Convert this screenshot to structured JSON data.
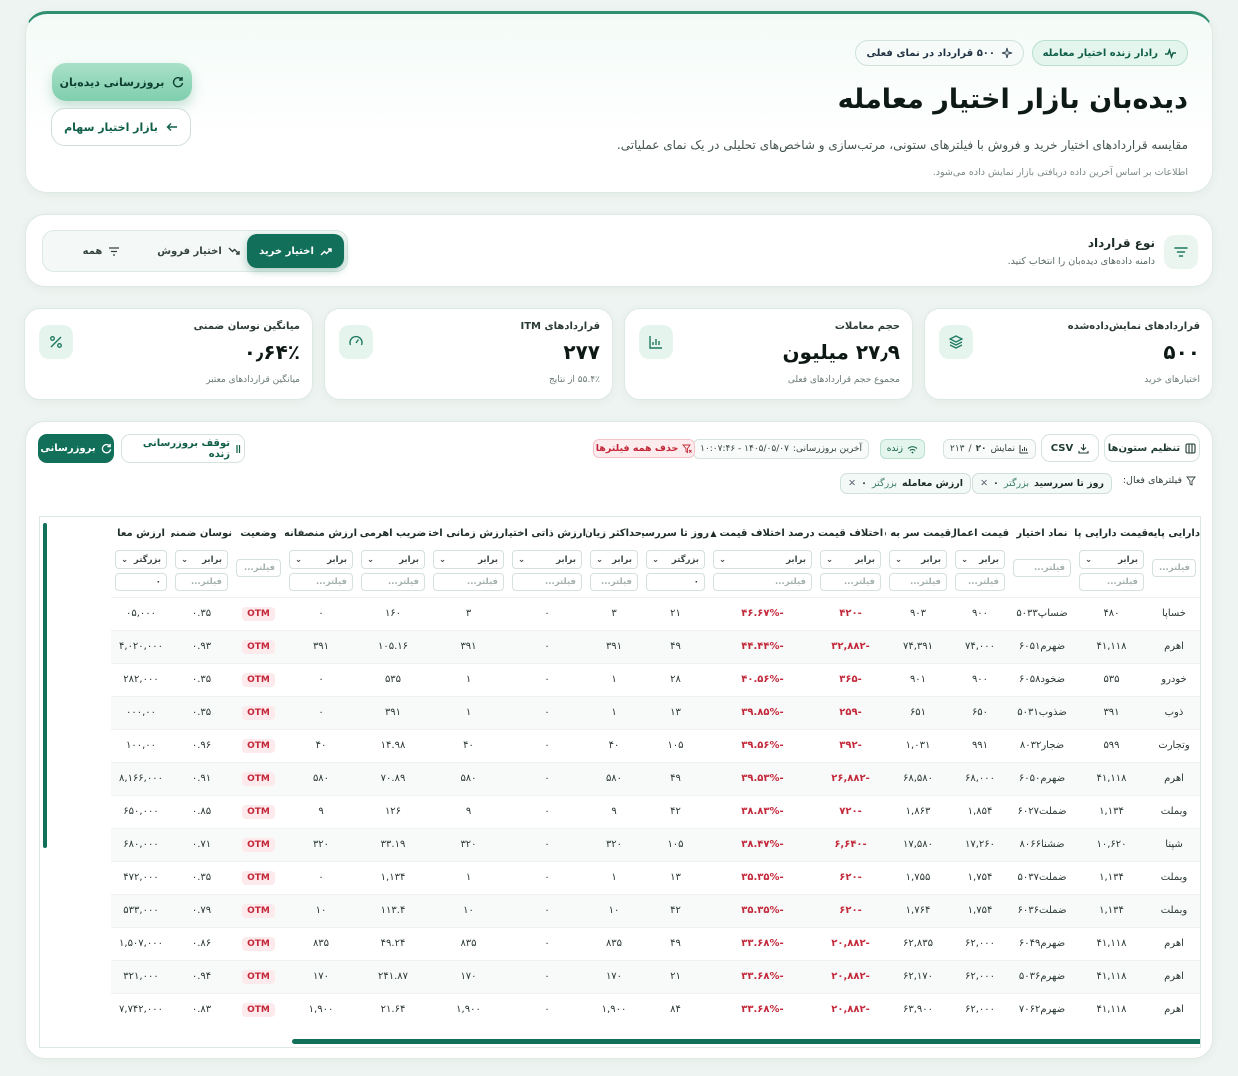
{
  "header": {
    "badge_live": "رادار زنده اختیار معامله",
    "badge_count": "۵۰۰ قرارداد در نمای فعلی",
    "title": "دیده‌بان بازار اختیار معامله",
    "description": "مقایسه قراردادهای اختیار خرید و فروش با فیلترهای ستونی، مرتب‌سازی و شاخص‌های تحلیلی در یک نمای عملیاتی.",
    "note": "اطلاعات بر اساس آخرین داده دریافتی بازار نمایش داده می‌شود.",
    "refresh_button": "بروزرسانی دیده‌بان",
    "stock_options_button": "بازار اختیار سهام"
  },
  "contract_filter": {
    "title": "نوع قرارداد",
    "subtitle": "دامنه داده‌های دیده‌بان را انتخاب کنید.",
    "options": [
      {
        "label": "اختیار خرید",
        "active": true
      },
      {
        "label": "اختیار فروش",
        "active": false
      },
      {
        "label": "همه",
        "active": false
      }
    ]
  },
  "stats": [
    {
      "label": "قراردادهای نمایش‌داده‌شده",
      "value": "۵۰۰",
      "hint": "اختیارهای خرید",
      "icon": "layers-icon"
    },
    {
      "label": "حجم معاملات",
      "value": "۲۷٫۹ میلیون",
      "hint": "مجموع حجم قراردادهای فعلی",
      "icon": "bar-chart-icon"
    },
    {
      "label": "قراردادهای ITM",
      "value": "۲۷۷",
      "hint": "۵۵.۴٪ از نتایج",
      "icon": "gauge-icon"
    },
    {
      "label": "میانگین نوسان ضمنی",
      "value": "۰٫۶۴٪",
      "hint": "میانگین قراردادهای معتبر",
      "icon": "percent-icon"
    }
  ],
  "toolbar": {
    "columns_button": "تنظیم ستون‌ها",
    "csv_button": "CSV",
    "display_label": "نمایش",
    "display_count": "۲۰",
    "display_total": "۲۱۳",
    "live_label": "زنده",
    "last_update_label": "آخرین بروزرسانی:",
    "last_update_value": "۱۴۰۵/۰۵/۰۷ - ۱۰:۰۷:۴۶",
    "clear_filters": "حذف همه فیلترها",
    "pause_button": "توقف بروزرسانی زنده",
    "refresh_button": "بروزرسانی",
    "active_filters_label": "فیلترهای فعال:",
    "active_filters": [
      {
        "name": "روز تا سررسید",
        "op": "بزرگتر",
        "value": "۰"
      },
      {
        "name": "ارزش معامله",
        "op": "بزرگتر",
        "value": "۰"
      }
    ]
  },
  "table": {
    "input_placeholder": "فیلتر...",
    "columns": [
      {
        "label": "دارایی پایه",
        "filter": null
      },
      {
        "label": "قیمت دارایی پایه",
        "filter": "برابر"
      },
      {
        "label": "نماد اختیار",
        "filter": null
      },
      {
        "label": "قیمت اعمال",
        "filter": "برابر"
      },
      {
        "label": "قیمت سر به سر",
        "filter": "برابر"
      },
      {
        "label": "اختلاف قیمت",
        "filter": "برابر"
      },
      {
        "label": "درصد اختلاف قیمت",
        "filter": "برابر"
      },
      {
        "label": "روز تا سررسید",
        "filter": "بزرگتر",
        "value": "۰"
      },
      {
        "label": "حداکثر زیان",
        "filter": "برابر"
      },
      {
        "label": "ارزش ذاتی اختیار",
        "filter": "برابر"
      },
      {
        "label": "ارزش زمانی اختیار",
        "filter": "برابر"
      },
      {
        "label": "ضریب اهرمی",
        "filter": "برابر"
      },
      {
        "label": "ارزش منصفانه",
        "filter": "برابر"
      },
      {
        "label": "وضعیت",
        "filter": null
      },
      {
        "label": "نوسان ضمنی",
        "filter": "برابر"
      },
      {
        "label": "ارزش معا",
        "filter": "بزرگتر",
        "value": "۰"
      }
    ],
    "rows": [
      [
        "خساپا",
        "۴۸۰",
        "ضساپ۵۰۳۳",
        "۹۰۰",
        "۹۰۳",
        "-۴۲۰",
        "-۴۶.۶۷%",
        "۲۱",
        "۳",
        "۰",
        "۳",
        "۱۶۰",
        "۰",
        "OTM",
        "۰.۳۵",
        "۰۵,۰۰۰"
      ],
      [
        "اهرم",
        "۴۱,۱۱۸",
        "ضهرم۶۰۵۱",
        "۷۴,۰۰۰",
        "۷۴,۳۹۱",
        "-۳۲,۸۸۲",
        "-۴۴.۴۴%",
        "۴۹",
        "۳۹۱",
        "۰",
        "۳۹۱",
        "۱۰۵.۱۶",
        "۳۹۱",
        "OTM",
        "۰.۹۳",
        "۴,۰۲۰,۰۰۰"
      ],
      [
        "خودرو",
        "۵۳۵",
        "ضخود۶۰۵۸",
        "۹۰۰",
        "۹۰۱",
        "-۳۶۵",
        "-۴۰.۵۶%",
        "۲۸",
        "۱",
        "۰",
        "۱",
        "۵۳۵",
        "۰",
        "OTM",
        "۰.۳۵",
        "۲۸۲,۰۰۰"
      ],
      [
        "ذوب",
        "۳۹۱",
        "ضذوب۵۰۳۱",
        "۶۵۰",
        "۶۵۱",
        "-۲۵۹",
        "-۳۹.۸۵%",
        "۱۳",
        "۱",
        "۰",
        "۱",
        "۳۹۱",
        "۰",
        "OTM",
        "۰.۳۵",
        "۰۰۰,۰۰"
      ],
      [
        "وتجارت",
        "۵۹۹",
        "ضجار۸۰۳۲",
        "۹۹۱",
        "۱,۰۳۱",
        "-۳۹۲",
        "-۳۹.۵۶%",
        "۱۰۵",
        "۴۰",
        "۰",
        "۴۰",
        "۱۴.۹۸",
        "۴۰",
        "OTM",
        "۰.۹۶",
        "۱۰۰,۰۰"
      ],
      [
        "اهرم",
        "۴۱,۱۱۸",
        "ضهرم۶۰۵۰",
        "۶۸,۰۰۰",
        "۶۸,۵۸۰",
        "-۲۶,۸۸۲",
        "-۳۹.۵۳%",
        "۴۹",
        "۵۸۰",
        "۰",
        "۵۸۰",
        "۷۰.۸۹",
        "۵۸۰",
        "OTM",
        "۰.۹۱",
        "۸,۱۶۶,۰۰۰"
      ],
      [
        "وبملت",
        "۱,۱۳۴",
        "ضملت۶۰۲۷",
        "۱,۸۵۴",
        "۱,۸۶۳",
        "-۷۲۰",
        "-۳۸.۸۳%",
        "۴۲",
        "۹",
        "۰",
        "۹",
        "۱۲۶",
        "۹",
        "OTM",
        "۰.۸۵",
        "۶۵۰,۰۰۰"
      ],
      [
        "شپنا",
        "۱۰,۶۲۰",
        "ضشنا۸۰۶۶",
        "۱۷,۲۶۰",
        "۱۷,۵۸۰",
        "-۶,۶۴۰",
        "-۳۸.۴۷%",
        "۱۰۵",
        "۳۲۰",
        "۰",
        "۳۲۰",
        "۳۳.۱۹",
        "۳۲۰",
        "OTM",
        "۰.۷۱",
        "۶۸۰,۰۰۰"
      ],
      [
        "وبملت",
        "۱,۱۳۴",
        "ضملت۵۰۳۷",
        "۱,۷۵۴",
        "۱,۷۵۵",
        "-۶۲۰",
        "-۳۵.۳۵%",
        "۱۳",
        "۱",
        "۰",
        "۱",
        "۱,۱۳۴",
        "۰",
        "OTM",
        "۰.۳۵",
        "۴۷۲,۰۰۰"
      ],
      [
        "وبملت",
        "۱,۱۳۴",
        "ضملت۶۰۳۶",
        "۱,۷۵۴",
        "۱,۷۶۴",
        "-۶۲۰",
        "-۳۵.۳۵%",
        "۴۲",
        "۱۰",
        "۰",
        "۱۰",
        "۱۱۳.۴",
        "۱۰",
        "OTM",
        "۰.۷۹",
        "۵۳۳,۰۰۰"
      ],
      [
        "اهرم",
        "۴۱,۱۱۸",
        "ضهرم۶۰۴۹",
        "۶۲,۰۰۰",
        "۶۲,۸۳۵",
        "-۲۰,۸۸۲",
        "-۳۳.۶۸%",
        "۴۹",
        "۸۳۵",
        "۰",
        "۸۳۵",
        "۴۹.۲۴",
        "۸۳۵",
        "OTM",
        "۰.۸۶",
        "۱,۵۰۷,۰۰۰"
      ],
      [
        "اهرم",
        "۴۱,۱۱۸",
        "ضهرم۵۰۳۶",
        "۶۲,۰۰۰",
        "۶۲,۱۷۰",
        "-۲۰,۸۸۲",
        "-۳۳.۶۸%",
        "۲۱",
        "۱۷۰",
        "۰",
        "۱۷۰",
        "۲۴۱.۸۷",
        "۱۷۰",
        "OTM",
        "۰.۹۴",
        "۳۲۱,۰۰۰"
      ],
      [
        "اهرم",
        "۴۱,۱۱۸",
        "ضهرم۷۰۶۲",
        "۶۲,۰۰۰",
        "۶۳,۹۰۰",
        "-۲۰,۸۸۲",
        "-۳۳.۶۸%",
        "۸۴",
        "۱,۹۰۰",
        "۰",
        "۱,۹۰۰",
        "۲۱.۶۴",
        "۱,۹۰۰",
        "OTM",
        "۰.۸۳",
        "۷,۷۴۲,۰۰۰"
      ]
    ]
  },
  "colors": {
    "brand": "#12705a",
    "negative": "#c3283a",
    "otm_bg": "#fdeaec"
  }
}
